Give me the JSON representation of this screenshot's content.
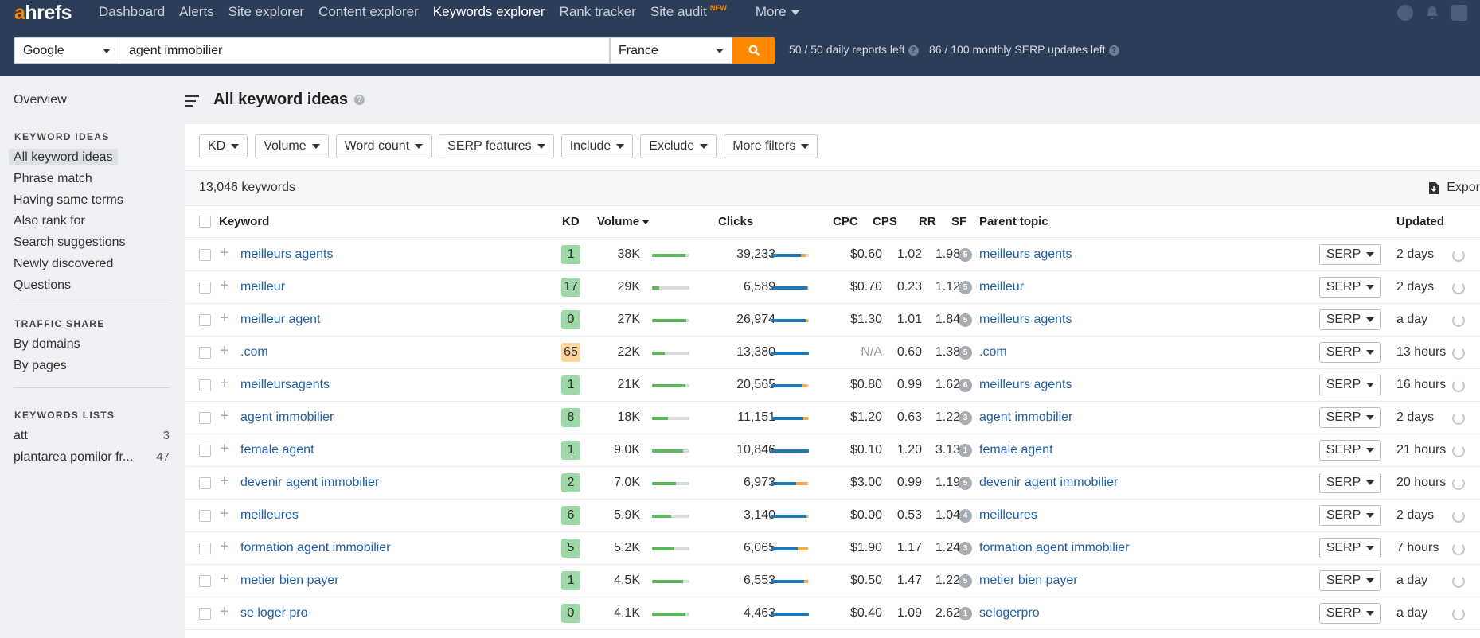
{
  "app": {
    "logo_a": "a",
    "logo_rest": "hrefs"
  },
  "nav": {
    "items": [
      "Dashboard",
      "Alerts",
      "Site explorer",
      "Content explorer",
      "Keywords explorer",
      "Rank tracker",
      "Site audit",
      "More"
    ],
    "active": "Keywords explorer",
    "new_badge": "NEW"
  },
  "search": {
    "engine": "Google",
    "query": "agent immobilier",
    "country": "France",
    "daily_reports": "50 / 50 daily reports left",
    "serp_updates": "86 / 100 monthly SERP updates left"
  },
  "sidebar": {
    "overview": "Overview",
    "keyword_ideas_heading": "KEYWORD IDEAS",
    "keyword_ideas": [
      "All keyword ideas",
      "Phrase match",
      "Having same terms",
      "Also rank for",
      "Search suggestions",
      "Newly discovered",
      "Questions"
    ],
    "traffic_share_heading": "TRAFFIC SHARE",
    "traffic_share": [
      "By domains",
      "By pages"
    ],
    "keyword_lists_heading": "KEYWORDS LISTS",
    "keyword_lists": [
      {
        "name": "att",
        "count": "3"
      },
      {
        "name": "plantarea pomilor fr...",
        "count": "47"
      }
    ]
  },
  "page": {
    "title": "All keyword ideas"
  },
  "filters": [
    "KD",
    "Volume",
    "Word count",
    "SERP features",
    "Include",
    "Exclude",
    "More filters"
  ],
  "results": {
    "count": "13,046 keywords",
    "export": "Expor"
  },
  "table": {
    "headers": {
      "keyword": "Keyword",
      "kd": "KD",
      "volume": "Volume",
      "clicks": "Clicks",
      "cpc": "CPC",
      "cps": "CPS",
      "rr": "RR",
      "sf": "SF",
      "parent_topic": "Parent topic",
      "updated": "Updated"
    },
    "serp_label": "SERP",
    "rows": [
      {
        "keyword": "meilleurs agents",
        "kd": "1",
        "volume": "38K",
        "volume_pct": 0.9,
        "clicks": "39,233",
        "clicks_organic": 0.78,
        "clicks_paid": 0.12,
        "cpc": "$0.60",
        "cps": "1.02",
        "rr": "1.98",
        "sf": "5",
        "parent_topic": "meilleurs agents",
        "updated": "2 days"
      },
      {
        "keyword": "meilleur",
        "kd": "17",
        "volume": "29K",
        "volume_pct": 0.2,
        "clicks": "6,589",
        "clicks_organic": 0.95,
        "clicks_paid": 0.03,
        "cpc": "$0.70",
        "cps": "0.23",
        "rr": "1.12",
        "sf": "5",
        "parent_topic": "meilleur",
        "updated": "2 days"
      },
      {
        "keyword": "meilleur agent",
        "kd": "0",
        "volume": "27K",
        "volume_pct": 0.92,
        "clicks": "26,974",
        "clicks_organic": 0.92,
        "clicks_paid": 0.06,
        "cpc": "$1.30",
        "cps": "1.01",
        "rr": "1.84",
        "sf": "5",
        "parent_topic": "meilleurs agents",
        "updated": "a day"
      },
      {
        "keyword": ".com",
        "kd": "65",
        "volume": "22K",
        "volume_pct": 0.35,
        "clicks": "13,380",
        "clicks_organic": 1.0,
        "clicks_paid": 0.0,
        "cpc": "N/A",
        "cps": "0.60",
        "rr": "1.38",
        "sf": "5",
        "parent_topic": ".com",
        "updated": "13 hours"
      },
      {
        "keyword": "meilleursagents",
        "kd": "1",
        "volume": "21K",
        "volume_pct": 0.9,
        "clicks": "20,565",
        "clicks_organic": 0.82,
        "clicks_paid": 0.12,
        "cpc": "$0.80",
        "cps": "0.99",
        "rr": "1.62",
        "sf": "6",
        "parent_topic": "meilleurs agents",
        "updated": "16 hours"
      },
      {
        "keyword": "agent immobilier",
        "kd": "8",
        "volume": "18K",
        "volume_pct": 0.42,
        "clicks": "11,151",
        "clicks_organic": 0.85,
        "clicks_paid": 0.12,
        "cpc": "$1.20",
        "cps": "0.63",
        "rr": "1.22",
        "sf": "3",
        "parent_topic": "agent immobilier",
        "updated": "2 days"
      },
      {
        "keyword": "female agent",
        "kd": "1",
        "volume": "9.0K",
        "volume_pct": 0.82,
        "clicks": "10,846",
        "clicks_organic": 1.0,
        "clicks_paid": 0.0,
        "cpc": "$0.10",
        "cps": "1.20",
        "rr": "3.13",
        "sf": "1",
        "parent_topic": "female agent",
        "updated": "21 hours"
      },
      {
        "keyword": "devenir agent immobilier",
        "kd": "2",
        "volume": "7.0K",
        "volume_pct": 0.64,
        "clicks": "6,973",
        "clicks_organic": 0.66,
        "clicks_paid": 0.3,
        "cpc": "$3.00",
        "cps": "0.99",
        "rr": "1.19",
        "sf": "5",
        "parent_topic": "devenir agent immobilier",
        "updated": "20 hours"
      },
      {
        "keyword": "meilleures",
        "kd": "6",
        "volume": "5.9K",
        "volume_pct": 0.5,
        "clicks": "3,140",
        "clicks_organic": 0.93,
        "clicks_paid": 0.04,
        "cpc": "$0.00",
        "cps": "0.53",
        "rr": "1.04",
        "sf": "4",
        "parent_topic": "meilleures",
        "updated": "2 days"
      },
      {
        "keyword": "formation agent immobilier",
        "kd": "5",
        "volume": "5.2K",
        "volume_pct": 0.6,
        "clicks": "6,065",
        "clicks_organic": 0.7,
        "clicks_paid": 0.27,
        "cpc": "$1.90",
        "cps": "1.17",
        "rr": "1.24",
        "sf": "3",
        "parent_topic": "formation agent immobilier",
        "updated": "7 hours"
      },
      {
        "keyword": "metier bien payer",
        "kd": "1",
        "volume": "4.5K",
        "volume_pct": 0.82,
        "clicks": "6,553",
        "clicks_organic": 0.88,
        "clicks_paid": 0.1,
        "cpc": "$0.50",
        "cps": "1.47",
        "rr": "1.22",
        "sf": "5",
        "parent_topic": "metier bien payer",
        "updated": "a day"
      },
      {
        "keyword": "se loger pro",
        "kd": "0",
        "volume": "4.1K",
        "volume_pct": 0.9,
        "clicks": "4,463",
        "clicks_organic": 1.0,
        "clicks_paid": 0.0,
        "cpc": "$0.40",
        "cps": "1.09",
        "rr": "2.62",
        "sf": "1",
        "parent_topic": "selogerpro",
        "updated": "a day"
      }
    ]
  },
  "colors": {
    "accent": "#ff8800",
    "topbar": "#2c3e57",
    "link": "#1e5fa8",
    "kd_easy": "#9fd8a8",
    "kd_medium": "#ffd59e"
  }
}
